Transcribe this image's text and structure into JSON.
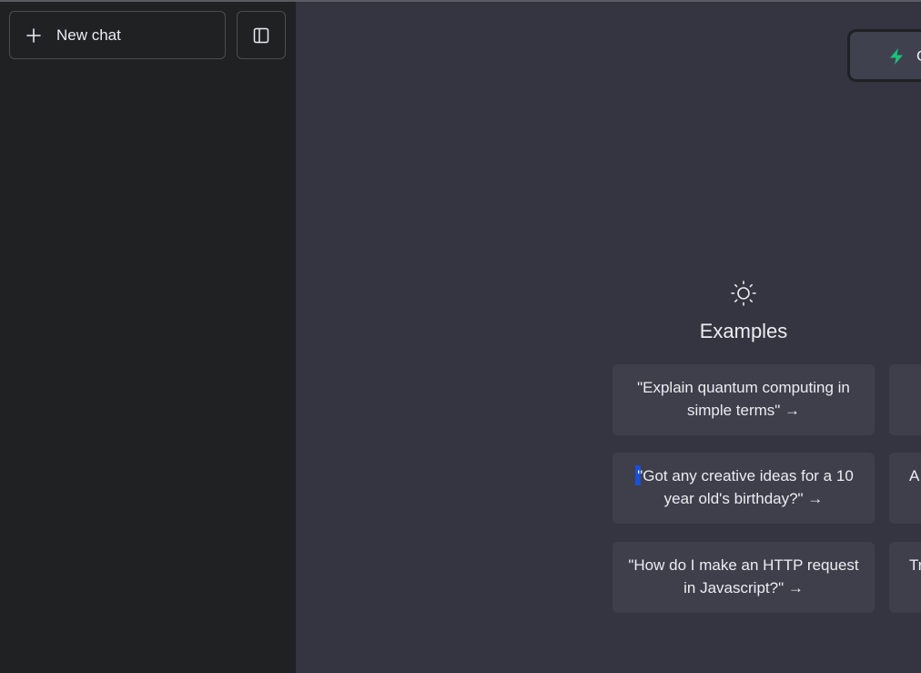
{
  "sidebar": {
    "new_chat_label": "New chat"
  },
  "header": {
    "model_label": "G"
  },
  "examples": {
    "title": "Examples",
    "items": [
      {
        "text": "\"Explain quantum computing in simple terms\" →"
      },
      {
        "text": "\"Got any creative ideas for a 10 year old's birthday?\" →"
      },
      {
        "text": "\"How do I make an HTTP request in Javascript?\" →"
      }
    ],
    "right_column": [
      {
        "text": ""
      },
      {
        "text": "A"
      },
      {
        "text": "Tr"
      }
    ]
  },
  "colors": {
    "sidebar_bg": "#202123",
    "main_bg": "#343541",
    "card_bg": "#3e3f4b",
    "accent_green": "#19c37d",
    "text": "#ececf1"
  },
  "icons": {
    "new_chat": "plus-icon",
    "toggle_sidebar": "sidebar-toggle-icon",
    "model": "lightning-bolt-icon",
    "examples": "sun-icon"
  }
}
